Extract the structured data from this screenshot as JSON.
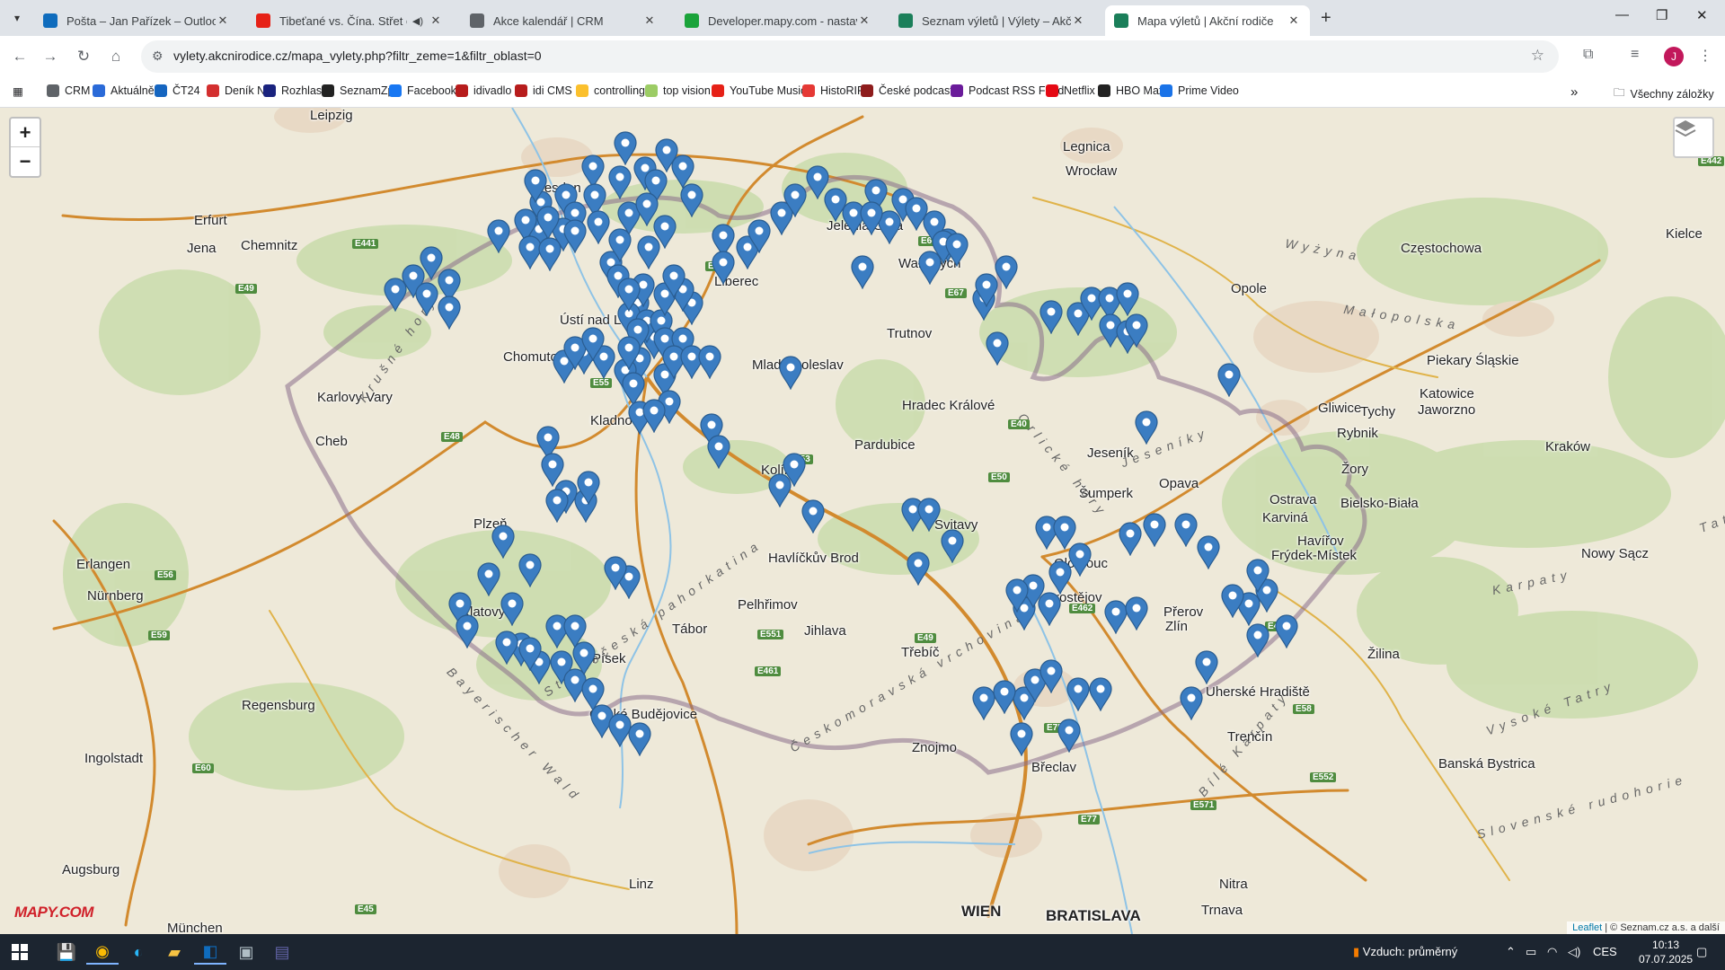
{
  "browser": {
    "tabs": [
      {
        "title": "Pošta – Jan Pařízek – Outlook",
        "icon": "outlook-icon",
        "color": "#0f6cbd",
        "active": false
      },
      {
        "title": "Tibeťané vs. Čína. Střet o vý",
        "icon": "youtube-icon",
        "color": "#e62117",
        "active": false,
        "audio": true
      },
      {
        "title": "Akce kalendář | CRM",
        "icon": "globe-icon",
        "color": "#5f6368",
        "active": false
      },
      {
        "title": "Developer.mapy.com - nastave",
        "icon": "mapy-dev-icon",
        "color": "#1aa33a",
        "active": false
      },
      {
        "title": "Seznam výletů | Výlety – Akční",
        "icon": "akcni-rodice-icon",
        "color": "#1b7f5a",
        "active": false
      },
      {
        "title": "Mapa výletů | Akční rodiče",
        "icon": "akcni-rodice-icon",
        "color": "#1b7f5a",
        "active": true
      }
    ],
    "url": "vylety.akcnirodice.cz/mapa_vylety.php?filtr_zeme=1&filtr_oblast=0",
    "profile_initial": "J"
  },
  "bookmarks": {
    "items": [
      {
        "label": "CRM",
        "icon": "globe-icon",
        "color": "#5f6368"
      },
      {
        "label": "Aktuálně",
        "icon": "aktualne-icon",
        "color": "#2a6ad8"
      },
      {
        "label": "ČT24",
        "icon": "ct24-icon",
        "color": "#1565c0"
      },
      {
        "label": "Deník N",
        "icon": "denik-n-icon",
        "color": "#d32f2f"
      },
      {
        "label": "Rozhlas",
        "icon": "rozhlas-icon",
        "color": "#1a237e"
      },
      {
        "label": "SeznamZp",
        "icon": "seznam-icon",
        "color": "#222222"
      },
      {
        "label": "Facebook",
        "icon": "facebook-icon",
        "color": "#1877f2"
      },
      {
        "label": "idivadlo",
        "icon": "idivadlo-icon",
        "color": "#b71c1c"
      },
      {
        "label": "idi CMS",
        "icon": "idivadlo-icon",
        "color": "#b71c1c"
      },
      {
        "label": "controlling",
        "icon": "controlling-icon",
        "color": "#fbc02d"
      },
      {
        "label": "top vision",
        "icon": "topvision-icon",
        "color": "#9ccc65"
      },
      {
        "label": "YouTube Music",
        "icon": "youtube-music-icon",
        "color": "#e62117"
      },
      {
        "label": "HistoRIP",
        "icon": "historip-icon",
        "color": "#e53935"
      },
      {
        "label": "České podcasty",
        "icon": "podcast-icon",
        "color": "#8e1c1c"
      },
      {
        "label": "Podcast RSS Feed",
        "icon": "podcast-rss-icon",
        "color": "#6a1b9a"
      },
      {
        "label": "Netflix",
        "icon": "netflix-icon",
        "color": "#e50914"
      },
      {
        "label": "HBO Max",
        "icon": "hbo-icon",
        "color": "#222222"
      },
      {
        "label": "Prime Video",
        "icon": "prime-icon",
        "color": "#1a73e8"
      }
    ],
    "all_bookmarks": "Všechny záložky"
  },
  "map": {
    "logo": "MAPY.COM",
    "attribution_leaflet": "Leaflet",
    "attribution_rest": "| © Seznam.cz a.s. a další",
    "pin_color": "#3b7dc2",
    "cities": [
      {
        "name": "Leipzig",
        "big": false
      },
      {
        "name": "Dresden",
        "big": false
      },
      {
        "name": "Erfurt",
        "big": false
      },
      {
        "name": "Jena",
        "big": false
      },
      {
        "name": "Chemnitz",
        "big": false
      },
      {
        "name": "Legnica",
        "big": false
      },
      {
        "name": "Wrocław",
        "big": false
      },
      {
        "name": "Jelenia Góra",
        "big": false
      },
      {
        "name": "Wałbrzych",
        "big": false
      },
      {
        "name": "Liberec",
        "big": false
      },
      {
        "name": "Opole",
        "big": false
      },
      {
        "name": "Częstochowa",
        "big": false
      },
      {
        "name": "Kielce",
        "big": false
      },
      {
        "name": "Ústí nad Labem",
        "big": false
      },
      {
        "name": "Chomutov",
        "big": false
      },
      {
        "name": "Karlovy Vary",
        "big": false
      },
      {
        "name": "Cheb",
        "big": false
      },
      {
        "name": "Trutnov",
        "big": false
      },
      {
        "name": "Mladá Boleslav",
        "big": false
      },
      {
        "name": "Hradec Králové",
        "big": false
      },
      {
        "name": "Pardubice",
        "big": false
      },
      {
        "name": "Kladno",
        "big": false
      },
      {
        "name": "Kolín",
        "big": false
      },
      {
        "name": "Plzeň",
        "big": false
      },
      {
        "name": "Piekary Śląskie",
        "big": false
      },
      {
        "name": "Katowice",
        "big": false
      },
      {
        "name": "Gliwice",
        "big": false
      },
      {
        "name": "Rybnik",
        "big": false
      },
      {
        "name": "Tychy",
        "big": false
      },
      {
        "name": "Jaworzno",
        "big": false
      },
      {
        "name": "Kraków",
        "big": false
      },
      {
        "name": "Jeseník",
        "big": false
      },
      {
        "name": "Šumperk",
        "big": false
      },
      {
        "name": "Opava",
        "big": false
      },
      {
        "name": "Ostrava",
        "big": false
      },
      {
        "name": "Karviná",
        "big": false
      },
      {
        "name": "Bielsko-Biała",
        "big": false
      },
      {
        "name": "Žory",
        "big": false
      },
      {
        "name": "Havířov",
        "big": false
      },
      {
        "name": "Frýdek-Místek",
        "big": false
      },
      {
        "name": "Nowy Sącz",
        "big": false
      },
      {
        "name": "Erlangen",
        "big": false
      },
      {
        "name": "Nürnberg",
        "big": false
      },
      {
        "name": "Klatovy",
        "big": false
      },
      {
        "name": "Havlíčkův Brod",
        "big": false
      },
      {
        "name": "Svitavy",
        "big": false
      },
      {
        "name": "Olomouc",
        "big": false
      },
      {
        "name": "Prostějov",
        "big": false
      },
      {
        "name": "Přerov",
        "big": false
      },
      {
        "name": "Zlín",
        "big": false
      },
      {
        "name": "Pelhřimov",
        "big": false
      },
      {
        "name": "Tábor",
        "big": false
      },
      {
        "name": "Jihlava",
        "big": false
      },
      {
        "name": "Písek",
        "big": false
      },
      {
        "name": "Třebíč",
        "big": false
      },
      {
        "name": "Regensburg",
        "big": false
      },
      {
        "name": "České Budějovice",
        "big": false
      },
      {
        "name": "Žilina",
        "big": false
      },
      {
        "name": "Ingolstadt",
        "big": false
      },
      {
        "name": "Znojmo",
        "big": false
      },
      {
        "name": "Uherské Hradiště",
        "big": false
      },
      {
        "name": "Trenčín",
        "big": false
      },
      {
        "name": "Banská Bystrica",
        "big": false
      },
      {
        "name": "Břeclav",
        "big": false
      },
      {
        "name": "Augsburg",
        "big": false
      },
      {
        "name": "Linz",
        "big": false
      },
      {
        "name": "WIEN",
        "big": true
      },
      {
        "name": "BRATISLAVA",
        "big": true
      },
      {
        "name": "Trnava",
        "big": false
      },
      {
        "name": "Nitra",
        "big": false
      },
      {
        "name": "München",
        "big": false
      }
    ],
    "regions": [
      {
        "name": "Krušné hory"
      },
      {
        "name": "Českomoravská vrchovina"
      },
      {
        "name": "Středočeská pahorkatina"
      },
      {
        "name": "Bayerischer Wald"
      },
      {
        "name": "Bílé Karpaty"
      },
      {
        "name": "Vysoké Tatry"
      },
      {
        "name": "Slovenské rudohorie"
      },
      {
        "name": "Małopolska"
      },
      {
        "name": "Wyżyna"
      },
      {
        "name": "Karpaty"
      },
      {
        "name": "Tatry"
      },
      {
        "name": "Jeseníky"
      },
      {
        "name": "Orlické hory"
      }
    ],
    "roads": [
      "E441",
      "E49",
      "E442",
      "E48",
      "E55",
      "E65",
      "E67",
      "E40",
      "E50",
      "E53",
      "E56",
      "E59",
      "E49",
      "E551",
      "E461",
      "E75",
      "E77",
      "E571",
      "E462",
      "E58",
      "E552",
      "E60",
      "E45",
      "E442",
      "E462"
    ]
  },
  "taskbar": {
    "apps": [
      {
        "name": "floppy-icon",
        "running": false
      },
      {
        "name": "chrome-icon",
        "running": true
      },
      {
        "name": "edge-icon",
        "running": false
      },
      {
        "name": "folder-icon",
        "running": false
      },
      {
        "name": "outlook-icon",
        "running": true
      },
      {
        "name": "app-icon",
        "running": false
      },
      {
        "name": "teams-icon",
        "running": false
      }
    ],
    "weather": "Vzduch: průměrný",
    "language": "CES",
    "time": "10:13",
    "date": "07.07.2025"
  }
}
